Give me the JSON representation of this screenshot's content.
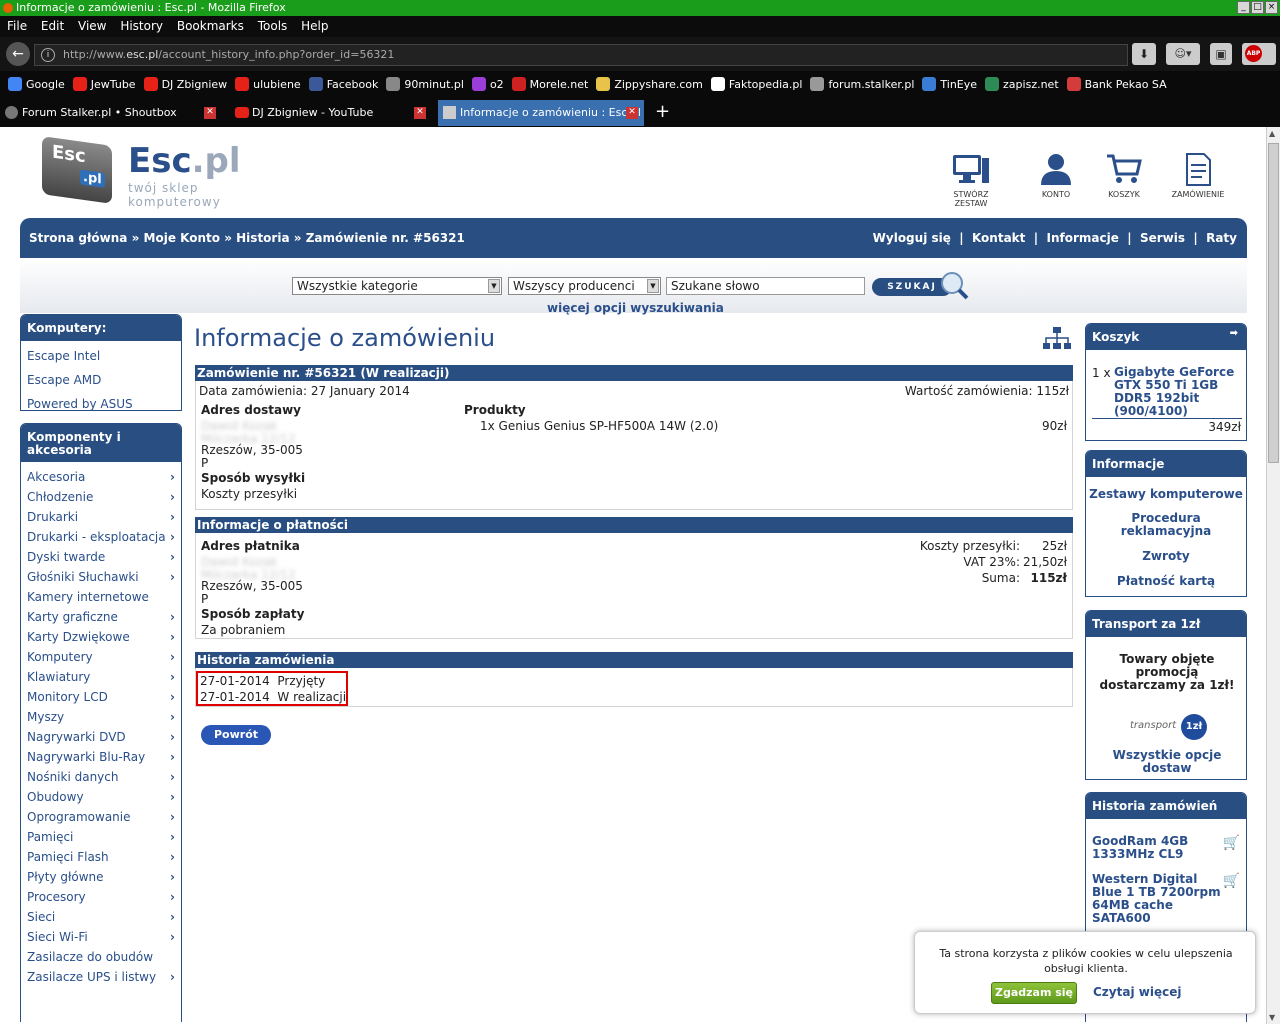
{
  "browser": {
    "window_title": "Informacje o zamówieniu : Esc.pl - Mozilla Firefox",
    "menu": [
      "File",
      "Edit",
      "View",
      "History",
      "Bookmarks",
      "Tools",
      "Help"
    ],
    "url_prefix": "http://www.",
    "url_domain": "esc.pl",
    "url_path": "/account_history_info.php?order_id=56321",
    "bookmarks": [
      {
        "label": "Google",
        "color": "#4285f4"
      },
      {
        "label": "JewTube",
        "color": "#e62117"
      },
      {
        "label": "DJ Zbigniew",
        "color": "#e62117"
      },
      {
        "label": "ulubiene",
        "color": "#e62117"
      },
      {
        "label": "Facebook",
        "color": "#3b5998"
      },
      {
        "label": "90minut.pl",
        "color": "#888888"
      },
      {
        "label": "o2",
        "color": "#9b3dd8"
      },
      {
        "label": "Morele.net",
        "color": "#cc2222"
      },
      {
        "label": "Zippyshare.com",
        "color": "#e8c34a"
      },
      {
        "label": "Faktopedia.pl",
        "color": "#ffffff"
      },
      {
        "label": "forum.stalker.pl",
        "color": "#999999"
      },
      {
        "label": "TinEye",
        "color": "#3a7bd5"
      },
      {
        "label": "zapisz.net",
        "color": "#2e8b57"
      },
      {
        "label": "Bank Pekao SA",
        "color": "#d43c3c"
      }
    ],
    "tabs": [
      {
        "label": "Forum Stalker.pl • Shoutbox"
      },
      {
        "label": "DJ Zbigniew - YouTube"
      },
      {
        "label": "Informacje o zamówieniu : Esc.pl"
      }
    ]
  },
  "site": {
    "logo_key": "Esc",
    "logo_key_sub": ".pl",
    "logo_name": "Esc",
    "logo_tld": ".pl",
    "tagline": "twój sklep komputerowy",
    "header_icons": [
      {
        "label": "STWÓRZ ZESTAW",
        "icon": "computer-icon"
      },
      {
        "label": "KONTO",
        "icon": "user-icon"
      },
      {
        "label": "KOSZYK",
        "icon": "cart-icon"
      },
      {
        "label": "ZAMÓWIENIE",
        "icon": "order-icon"
      }
    ],
    "breadcrumb": [
      "Strona główna",
      "Moje Konto",
      "Historia",
      "Zamówienie nr. #56321"
    ],
    "breadcrumb_sep": "»",
    "top_links": [
      "Wyloguj się",
      "Kontakt",
      "Informacje",
      "Serwis",
      "Raty"
    ],
    "search": {
      "category": "Wszystkie kategorie",
      "producer": "Wszyscy producenci",
      "keyword": "Szukane słowo",
      "button": "SZUKAJ",
      "more_options": "więcej opcji wyszukiwania"
    }
  },
  "sidebar_left": {
    "computers_title": "Komputery:",
    "computers": [
      "Escape Intel",
      "Escape AMD",
      "Powered by ASUS"
    ],
    "components_title": "Komponenty i akcesoria",
    "components": [
      {
        "label": "Akcesoria",
        "arrow": true
      },
      {
        "label": "Chłodzenie",
        "arrow": true
      },
      {
        "label": "Drukarki",
        "arrow": true
      },
      {
        "label": "Drukarki - eksploatacja",
        "arrow": true
      },
      {
        "label": "Dyski twarde",
        "arrow": true
      },
      {
        "label": "Głośniki Słuchawki",
        "arrow": true
      },
      {
        "label": "Kamery internetowe",
        "arrow": false
      },
      {
        "label": "Karty graficzne",
        "arrow": true
      },
      {
        "label": "Karty Dzwiękowe",
        "arrow": true
      },
      {
        "label": "Komputery",
        "arrow": true
      },
      {
        "label": "Klawiatury",
        "arrow": true
      },
      {
        "label": "Monitory LCD",
        "arrow": true
      },
      {
        "label": "Myszy",
        "arrow": true
      },
      {
        "label": "Nagrywarki DVD",
        "arrow": true
      },
      {
        "label": "Nagrywarki Blu-Ray",
        "arrow": true
      },
      {
        "label": "Nośniki danych",
        "arrow": true
      },
      {
        "label": "Obudowy",
        "arrow": true
      },
      {
        "label": "Oprogramowanie",
        "arrow": true
      },
      {
        "label": "Pamięci",
        "arrow": true
      },
      {
        "label": "Pamięci Flash",
        "arrow": true
      },
      {
        "label": "Płyty główne",
        "arrow": true
      },
      {
        "label": "Procesory",
        "arrow": true
      },
      {
        "label": "Sieci",
        "arrow": true
      },
      {
        "label": "Sieci Wi-Fi",
        "arrow": true
      },
      {
        "label": "Zasilacze do obudów",
        "arrow": false
      },
      {
        "label": "Zasilacze UPS i listwy",
        "arrow": true
      }
    ]
  },
  "main": {
    "page_title": "Informacje o zamówieniu",
    "order_header": "Zamówienie nr. #56321 (W realizacji)",
    "order_date": "Data zamówienia: 27 January 2014",
    "order_value": "Wartość zamówienia: 115zł",
    "delivery_title": "Adres dostawy",
    "delivery_blur1": "Dawid Kozak",
    "delivery_blur2": "Milczarka 12/12",
    "delivery_city": "Rzeszów, 35-005",
    "delivery_p": "P",
    "shipping_title": "Sposób wysyłki",
    "shipping_value": "Koszty przesyłki",
    "products_title": "Produkty",
    "product_line": "1x Genius Genius SP-HF500A 14W (2.0)",
    "product_price": "90zł",
    "payment_header": "Informacje o płatności",
    "payer_title": "Adres płatnika",
    "payer_blur1": "Dawid Kozak",
    "payer_blur2": "Milczarka 12/12",
    "payer_city": "Rzeszów, 35-005",
    "payer_p": "P",
    "payment_method_title": "Sposób zapłaty",
    "payment_method": "Za pobraniem",
    "totals": [
      {
        "label": "Koszty przesyłki:",
        "value": "25zł"
      },
      {
        "label": "VAT 23%:",
        "value": "21,50zł"
      },
      {
        "label": "Suma:",
        "value": "115zł"
      }
    ],
    "history_header": "Historia zamówienia",
    "history": [
      {
        "date": "27-01-2014",
        "status": "Przyjęty"
      },
      {
        "date": "27-01-2014",
        "status": "W realizacji"
      }
    ],
    "back_button": "Powrót"
  },
  "sidebar_right": {
    "cart_title": "Koszyk",
    "cart_qty": "1 x",
    "cart_item": "Gigabyte GeForce GTX 550 Ti 1GB DDR5 192bit (900/4100)",
    "cart_total": "349zł",
    "info_title": "Informacje",
    "info_links": [
      "Zestawy komputerowe",
      "Procedura reklamacyjna",
      "Zwroty",
      "Płatność kartą"
    ],
    "transport_title": "Transport za 1zł",
    "transport_text": "Towary objęte promocją dostarczamy za 1zł!",
    "transport_logo_text": "transport",
    "transport_logo_badge": "1zł",
    "transport_link": "Wszystkie opcje dostaw",
    "history_title": "Historia zamówień",
    "history_items": [
      "GoodRam 4GB 1333MHz CL9",
      "Western Digital Blue 1 TB 7200rpm 64MB cache SATA600"
    ]
  },
  "cookie": {
    "text": "Ta strona korzysta z plików cookies w celu ulepszenia obsługi klienta.",
    "accept": "Zgadzam się",
    "more": "Czytaj więcej"
  }
}
